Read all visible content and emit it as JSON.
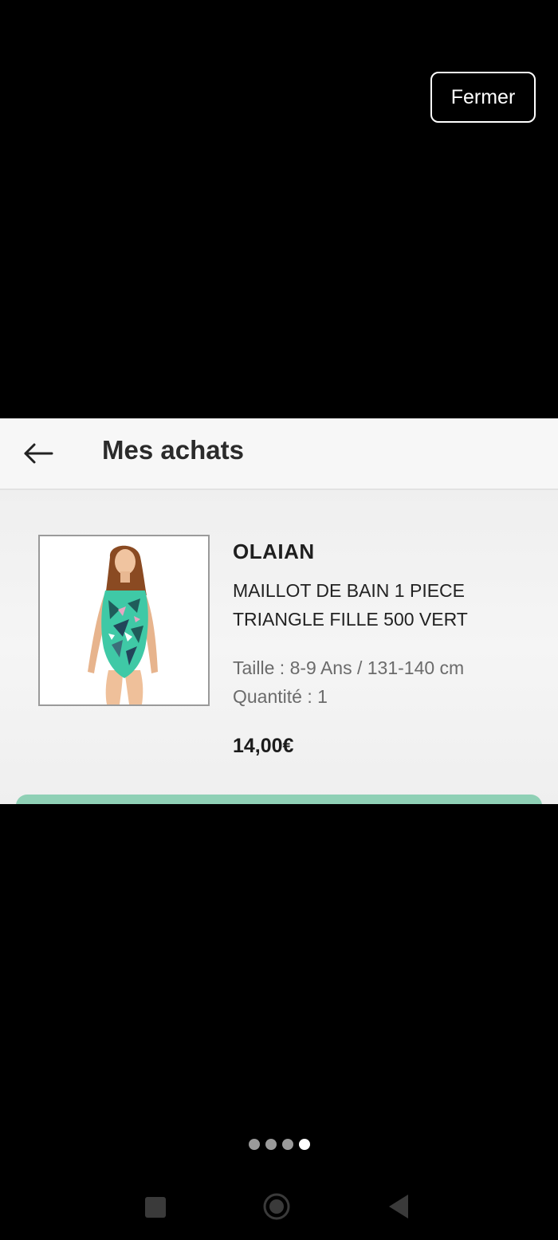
{
  "overlay": {
    "close_label": "Fermer"
  },
  "app": {
    "title": "Mes achats",
    "back_icon": "arrow-left-icon"
  },
  "product": {
    "brand": "OLAIAN",
    "name": "MAILLOT DE BAIN 1 PIECE TRIANGLE FILLE 500 VERT",
    "size": "Taille : 8-9 Ans / 131-140 cm",
    "quantity": "Quantité : 1",
    "price": "14,00€",
    "image": "girl-swimsuit-photo"
  },
  "pager": {
    "total": 4,
    "active_index": 3
  },
  "colors": {
    "background": "#000000",
    "accent_green": "#8fd0b5",
    "swimsuit_teal": "#3fc9a6"
  },
  "system_nav": {
    "recents_icon": "square-icon",
    "home_icon": "home-circle-icon",
    "back_icon": "triangle-back-icon"
  }
}
